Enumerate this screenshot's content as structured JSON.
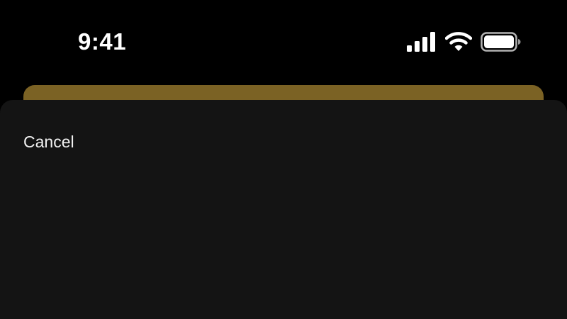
{
  "status_bar": {
    "time": "9:41",
    "icons": [
      "cellular-signal-icon",
      "wifi-icon",
      "battery-icon"
    ]
  },
  "colors": {
    "background": "#000000",
    "sheet": "#141414",
    "back_card": "#7b6224",
    "text": "#ffffff"
  },
  "sheet": {
    "cancel_label": "Cancel"
  }
}
